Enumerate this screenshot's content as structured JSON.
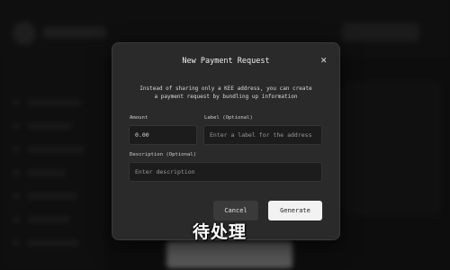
{
  "modal": {
    "title": "New Payment Request",
    "close_symbol": "✕",
    "description_line1": "Instead of sharing only a KEE address, you can create",
    "description_line2": "a payment request by bundling up information",
    "amount_label": "Amount",
    "amount_value": "0.00",
    "label_label": "Label (Optional)",
    "label_placeholder": "Enter a label for the address",
    "description_label": "Description (Optional)",
    "description_placeholder": "Enter description",
    "cancel_label": "Cancel",
    "generate_label": "Generate"
  },
  "watermark": "待处理",
  "icons": {
    "close": "close-icon"
  }
}
